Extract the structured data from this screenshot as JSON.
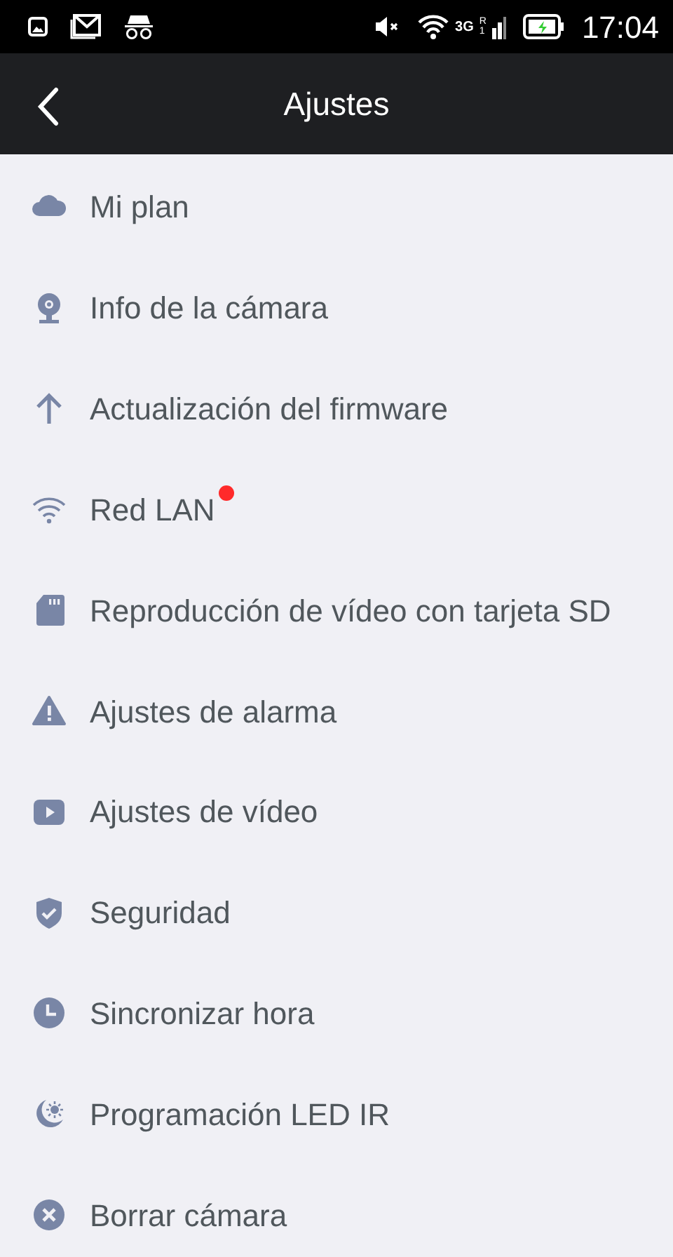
{
  "status_bar": {
    "network": "3G",
    "roaming": "R",
    "sim": "1",
    "time": "17:04"
  },
  "header": {
    "title": "Ajustes"
  },
  "items": [
    {
      "label": "Mi plan",
      "badge": false
    },
    {
      "label": "Info de la cámara",
      "badge": false
    },
    {
      "label": "Actualización del firmware",
      "badge": false
    },
    {
      "label": "Red LAN",
      "badge": true
    },
    {
      "label": "Reproducción de vídeo con tarjeta SD",
      "badge": false
    },
    {
      "label": "Ajustes de alarma",
      "badge": false
    },
    {
      "label": "Ajustes de vídeo",
      "badge": false
    },
    {
      "label": "Seguridad",
      "badge": false
    },
    {
      "label": "Sincronizar hora",
      "badge": false
    },
    {
      "label": "Programación LED IR",
      "badge": false
    },
    {
      "label": "Borrar cámara",
      "badge": false
    }
  ]
}
